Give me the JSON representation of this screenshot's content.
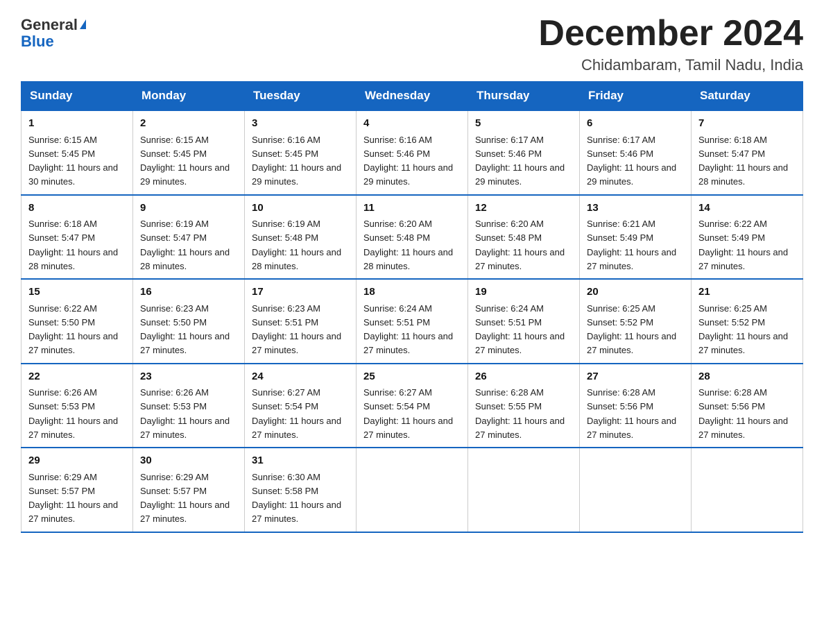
{
  "header": {
    "logo_general": "General",
    "logo_blue": "Blue",
    "month_title": "December 2024",
    "location": "Chidambaram, Tamil Nadu, India"
  },
  "weekdays": [
    "Sunday",
    "Monday",
    "Tuesday",
    "Wednesday",
    "Thursday",
    "Friday",
    "Saturday"
  ],
  "weeks": [
    [
      {
        "day": "1",
        "sunrise": "6:15 AM",
        "sunset": "5:45 PM",
        "daylight": "11 hours and 30 minutes."
      },
      {
        "day": "2",
        "sunrise": "6:15 AM",
        "sunset": "5:45 PM",
        "daylight": "11 hours and 29 minutes."
      },
      {
        "day": "3",
        "sunrise": "6:16 AM",
        "sunset": "5:45 PM",
        "daylight": "11 hours and 29 minutes."
      },
      {
        "day": "4",
        "sunrise": "6:16 AM",
        "sunset": "5:46 PM",
        "daylight": "11 hours and 29 minutes."
      },
      {
        "day": "5",
        "sunrise": "6:17 AM",
        "sunset": "5:46 PM",
        "daylight": "11 hours and 29 minutes."
      },
      {
        "day": "6",
        "sunrise": "6:17 AM",
        "sunset": "5:46 PM",
        "daylight": "11 hours and 29 minutes."
      },
      {
        "day": "7",
        "sunrise": "6:18 AM",
        "sunset": "5:47 PM",
        "daylight": "11 hours and 28 minutes."
      }
    ],
    [
      {
        "day": "8",
        "sunrise": "6:18 AM",
        "sunset": "5:47 PM",
        "daylight": "11 hours and 28 minutes."
      },
      {
        "day": "9",
        "sunrise": "6:19 AM",
        "sunset": "5:47 PM",
        "daylight": "11 hours and 28 minutes."
      },
      {
        "day": "10",
        "sunrise": "6:19 AM",
        "sunset": "5:48 PM",
        "daylight": "11 hours and 28 minutes."
      },
      {
        "day": "11",
        "sunrise": "6:20 AM",
        "sunset": "5:48 PM",
        "daylight": "11 hours and 28 minutes."
      },
      {
        "day": "12",
        "sunrise": "6:20 AM",
        "sunset": "5:48 PM",
        "daylight": "11 hours and 27 minutes."
      },
      {
        "day": "13",
        "sunrise": "6:21 AM",
        "sunset": "5:49 PM",
        "daylight": "11 hours and 27 minutes."
      },
      {
        "day": "14",
        "sunrise": "6:22 AM",
        "sunset": "5:49 PM",
        "daylight": "11 hours and 27 minutes."
      }
    ],
    [
      {
        "day": "15",
        "sunrise": "6:22 AM",
        "sunset": "5:50 PM",
        "daylight": "11 hours and 27 minutes."
      },
      {
        "day": "16",
        "sunrise": "6:23 AM",
        "sunset": "5:50 PM",
        "daylight": "11 hours and 27 minutes."
      },
      {
        "day": "17",
        "sunrise": "6:23 AM",
        "sunset": "5:51 PM",
        "daylight": "11 hours and 27 minutes."
      },
      {
        "day": "18",
        "sunrise": "6:24 AM",
        "sunset": "5:51 PM",
        "daylight": "11 hours and 27 minutes."
      },
      {
        "day": "19",
        "sunrise": "6:24 AM",
        "sunset": "5:51 PM",
        "daylight": "11 hours and 27 minutes."
      },
      {
        "day": "20",
        "sunrise": "6:25 AM",
        "sunset": "5:52 PM",
        "daylight": "11 hours and 27 minutes."
      },
      {
        "day": "21",
        "sunrise": "6:25 AM",
        "sunset": "5:52 PM",
        "daylight": "11 hours and 27 minutes."
      }
    ],
    [
      {
        "day": "22",
        "sunrise": "6:26 AM",
        "sunset": "5:53 PM",
        "daylight": "11 hours and 27 minutes."
      },
      {
        "day": "23",
        "sunrise": "6:26 AM",
        "sunset": "5:53 PM",
        "daylight": "11 hours and 27 minutes."
      },
      {
        "day": "24",
        "sunrise": "6:27 AM",
        "sunset": "5:54 PM",
        "daylight": "11 hours and 27 minutes."
      },
      {
        "day": "25",
        "sunrise": "6:27 AM",
        "sunset": "5:54 PM",
        "daylight": "11 hours and 27 minutes."
      },
      {
        "day": "26",
        "sunrise": "6:28 AM",
        "sunset": "5:55 PM",
        "daylight": "11 hours and 27 minutes."
      },
      {
        "day": "27",
        "sunrise": "6:28 AM",
        "sunset": "5:56 PM",
        "daylight": "11 hours and 27 minutes."
      },
      {
        "day": "28",
        "sunrise": "6:28 AM",
        "sunset": "5:56 PM",
        "daylight": "11 hours and 27 minutes."
      }
    ],
    [
      {
        "day": "29",
        "sunrise": "6:29 AM",
        "sunset": "5:57 PM",
        "daylight": "11 hours and 27 minutes."
      },
      {
        "day": "30",
        "sunrise": "6:29 AM",
        "sunset": "5:57 PM",
        "daylight": "11 hours and 27 minutes."
      },
      {
        "day": "31",
        "sunrise": "6:30 AM",
        "sunset": "5:58 PM",
        "daylight": "11 hours and 27 minutes."
      },
      null,
      null,
      null,
      null
    ]
  ]
}
